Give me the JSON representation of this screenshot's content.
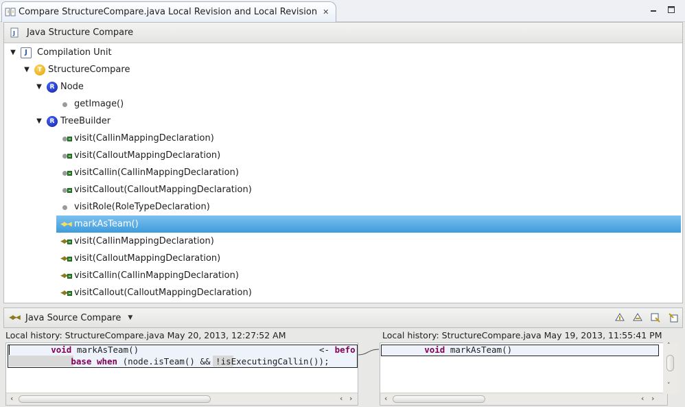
{
  "window": {
    "title": "Compare StructureCompare.java Local Revision and Local Revision",
    "close_glyph": "✕"
  },
  "structure_panel": {
    "title": "Java Structure Compare",
    "tree": [
      {
        "label": "Compilation Unit",
        "icon": "compilation-unit-icon",
        "level": 0,
        "expander": "expanded"
      },
      {
        "label": "StructureCompare",
        "icon": "team-class-icon",
        "level": 1,
        "expander": "expanded"
      },
      {
        "label": "Node",
        "icon": "role-class-icon",
        "level": 2,
        "expander": "expanded"
      },
      {
        "label": "getImage()",
        "icon": "method-icon",
        "level": 3,
        "expander": "none"
      },
      {
        "label": "TreeBuilder",
        "icon": "role-class-icon",
        "level": 2,
        "expander": "expanded"
      },
      {
        "label": "visit(CallinMappingDeclaration)",
        "icon": "method-removed-icon",
        "level": 3,
        "expander": "none"
      },
      {
        "label": "visit(CalloutMappingDeclaration)",
        "icon": "method-removed-icon",
        "level": 3,
        "expander": "none"
      },
      {
        "label": "visitCallin(CallinMappingDeclaration)",
        "icon": "method-added-icon",
        "level": 3,
        "expander": "none"
      },
      {
        "label": "visitCallout(CalloutMappingDeclaration)",
        "icon": "method-added-icon",
        "level": 3,
        "expander": "none"
      },
      {
        "label": "visitRole(RoleTypeDeclaration)",
        "icon": "method-icon",
        "level": 3,
        "expander": "none"
      },
      {
        "label": "markAsTeam()",
        "icon": "callin-binding-icon",
        "level": 3,
        "expander": "none",
        "selected": true
      },
      {
        "label": "visit(CallinMappingDeclaration)",
        "icon": "callin-binding-removed-icon",
        "level": 3,
        "expander": "none"
      },
      {
        "label": "visit(CalloutMappingDeclaration)",
        "icon": "callin-binding-removed-icon",
        "level": 3,
        "expander": "none"
      },
      {
        "label": "visitCallin(CallinMappingDeclaration)",
        "icon": "callin-binding-added-icon",
        "level": 3,
        "expander": "none"
      },
      {
        "label": "visitCallout(CalloutMappingDeclaration)",
        "icon": "callin-binding-added-icon",
        "level": 3,
        "expander": "none"
      }
    ]
  },
  "source_panel": {
    "title": "Java Source Compare",
    "left_label": "Local history: StructureCompare.java May 20, 2013, 12:27:52 AM",
    "right_label": "Local history: StructureCompare.java May 19, 2013, 11:55:41 PM",
    "left_code": {
      "line1_kw": "void",
      "line1_rest": " markAsTeam()",
      "line1_tail": "<- ",
      "line1_tail_kw": "befo",
      "line2_kw1": "base",
      "line2_kw2": "when",
      "line2_rest": " (node.isTeam() && !isExecutingCallin());"
    },
    "right_code": {
      "line1_kw": "void",
      "line1_rest": " markAsTeam()"
    }
  }
}
